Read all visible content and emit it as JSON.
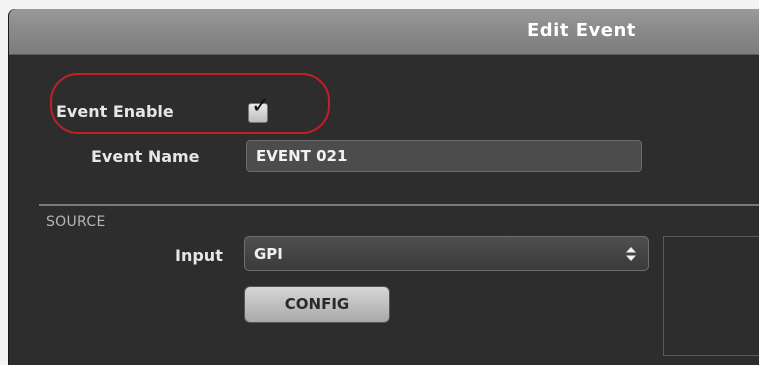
{
  "window": {
    "title": "Edit Event"
  },
  "event": {
    "enable_label": "Event Enable",
    "enabled": true,
    "name_label": "Event Name",
    "name_value": "EVENT 021"
  },
  "source": {
    "section_label": "SOURCE",
    "input_label": "Input",
    "input_value": "GPI",
    "config_label": "CONFIG"
  },
  "icons": {
    "select_arrows": "up-down-arrows-icon",
    "checkmark": "checkmark-icon"
  },
  "colors": {
    "titlebar": "#8a8a8a",
    "panel_background": "#2d2d2d",
    "highlight": "#c0202a",
    "button": "#c4c4c4"
  }
}
